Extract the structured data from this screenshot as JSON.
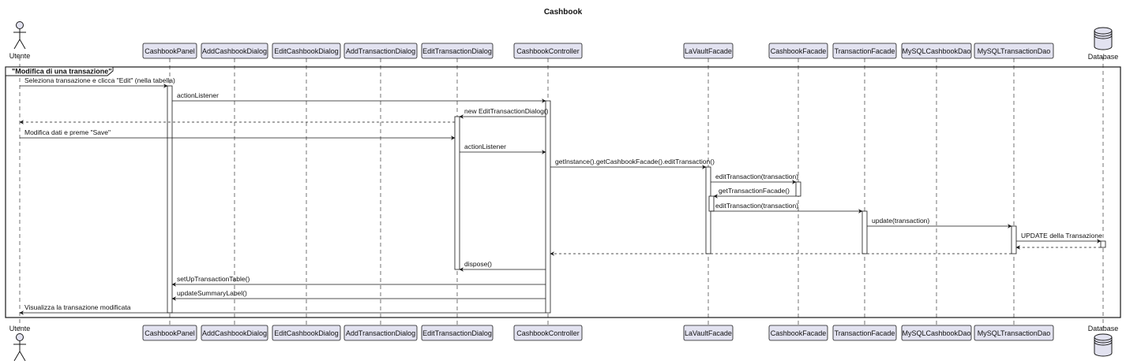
{
  "title": "Cashbook",
  "colors": {
    "participant_fill": "#e2e2f0",
    "participant_stroke": "#181818",
    "lifeline": "#181818",
    "line": "#181818"
  },
  "participants": [
    {
      "id": "utente",
      "name": "Utente",
      "kind": "actor"
    },
    {
      "id": "cashbookpanel",
      "name": "CashbookPanel",
      "kind": "box"
    },
    {
      "id": "addcashbookdialog",
      "name": "AddCashbookDialog",
      "kind": "box"
    },
    {
      "id": "editcashbookdialog",
      "name": "EditCashbookDialog",
      "kind": "box"
    },
    {
      "id": "addtransactiondialog",
      "name": "AddTransactionDialog",
      "kind": "box"
    },
    {
      "id": "edittransactiondialog",
      "name": "EditTransactionDialog",
      "kind": "box"
    },
    {
      "id": "cashbookcontroller",
      "name": "CashbookController",
      "kind": "box"
    },
    {
      "id": "lavaultfacade",
      "name": "LaVaultFacade",
      "kind": "box"
    },
    {
      "id": "cashbookfacade",
      "name": "CashbookFacade",
      "kind": "box"
    },
    {
      "id": "transactionfacade",
      "name": "TransactionFacade",
      "kind": "box"
    },
    {
      "id": "mysqlcashbookdao",
      "name": "MySQLCashbookDao",
      "kind": "box"
    },
    {
      "id": "mysqltransactiondao",
      "name": "MySQLTransactionDao",
      "kind": "box"
    },
    {
      "id": "database",
      "name": "Database",
      "kind": "database"
    }
  ],
  "frame_label": "\"Modifica di una transazione\"",
  "messages": [
    {
      "from": "utente",
      "to": "cashbookpanel",
      "label": "Seleziona transazione e clicca \"Edit\" (nella tabella)",
      "dashed": false
    },
    {
      "from": "cashbookpanel",
      "to": "cashbookcontroller",
      "label": "actionListener",
      "dashed": false
    },
    {
      "from": "cashbookcontroller",
      "to": "edittransactiondialog",
      "label": "new EditTransactionDialog()",
      "dashed": false
    },
    {
      "from": "edittransactiondialog",
      "to": "utente",
      "label": "",
      "dashed": true
    },
    {
      "from": "utente",
      "to": "edittransactiondialog",
      "label": "Modifica dati e preme \"Save\"",
      "dashed": false
    },
    {
      "from": "edittransactiondialog",
      "to": "cashbookcontroller",
      "label": "actionListener",
      "dashed": false
    },
    {
      "from": "cashbookcontroller",
      "to": "lavaultfacade",
      "label": "getInstance().getCashbookFacade().editTransaction()",
      "dashed": false
    },
    {
      "from": "lavaultfacade",
      "to": "cashbookfacade",
      "label": "editTransaction(transaction)",
      "dashed": false
    },
    {
      "from": "cashbookfacade",
      "to": "lavaultfacade",
      "label": "getTransactionFacade()",
      "dashed": false
    },
    {
      "from": "lavaultfacade",
      "to": "transactionfacade",
      "label": "editTransaction(transaction)",
      "dashed": false
    },
    {
      "from": "transactionfacade",
      "to": "mysqltransactiondao",
      "label": "update(transaction)",
      "dashed": false
    },
    {
      "from": "mysqltransactiondao",
      "to": "database",
      "label": "UPDATE della Transazione",
      "dashed": false
    },
    {
      "from": "database",
      "to": "mysqltransactiondao",
      "label": "",
      "dashed": true
    },
    {
      "from": "mysqltransactiondao",
      "to": "cashbookcontroller",
      "label": "",
      "dashed": true
    },
    {
      "from": "cashbookcontroller",
      "to": "edittransactiondialog",
      "label": "dispose()",
      "dashed": false
    },
    {
      "from": "cashbookcontroller",
      "to": "cashbookpanel",
      "label": "setUpTransactionTable()",
      "dashed": false
    },
    {
      "from": "cashbookcontroller",
      "to": "cashbookpanel",
      "label": "updateSummaryLabel()",
      "dashed": false
    },
    {
      "from": "cashbookcontroller",
      "to": "utente",
      "label": "Visualizza la transazione modificata",
      "dashed": false
    }
  ]
}
